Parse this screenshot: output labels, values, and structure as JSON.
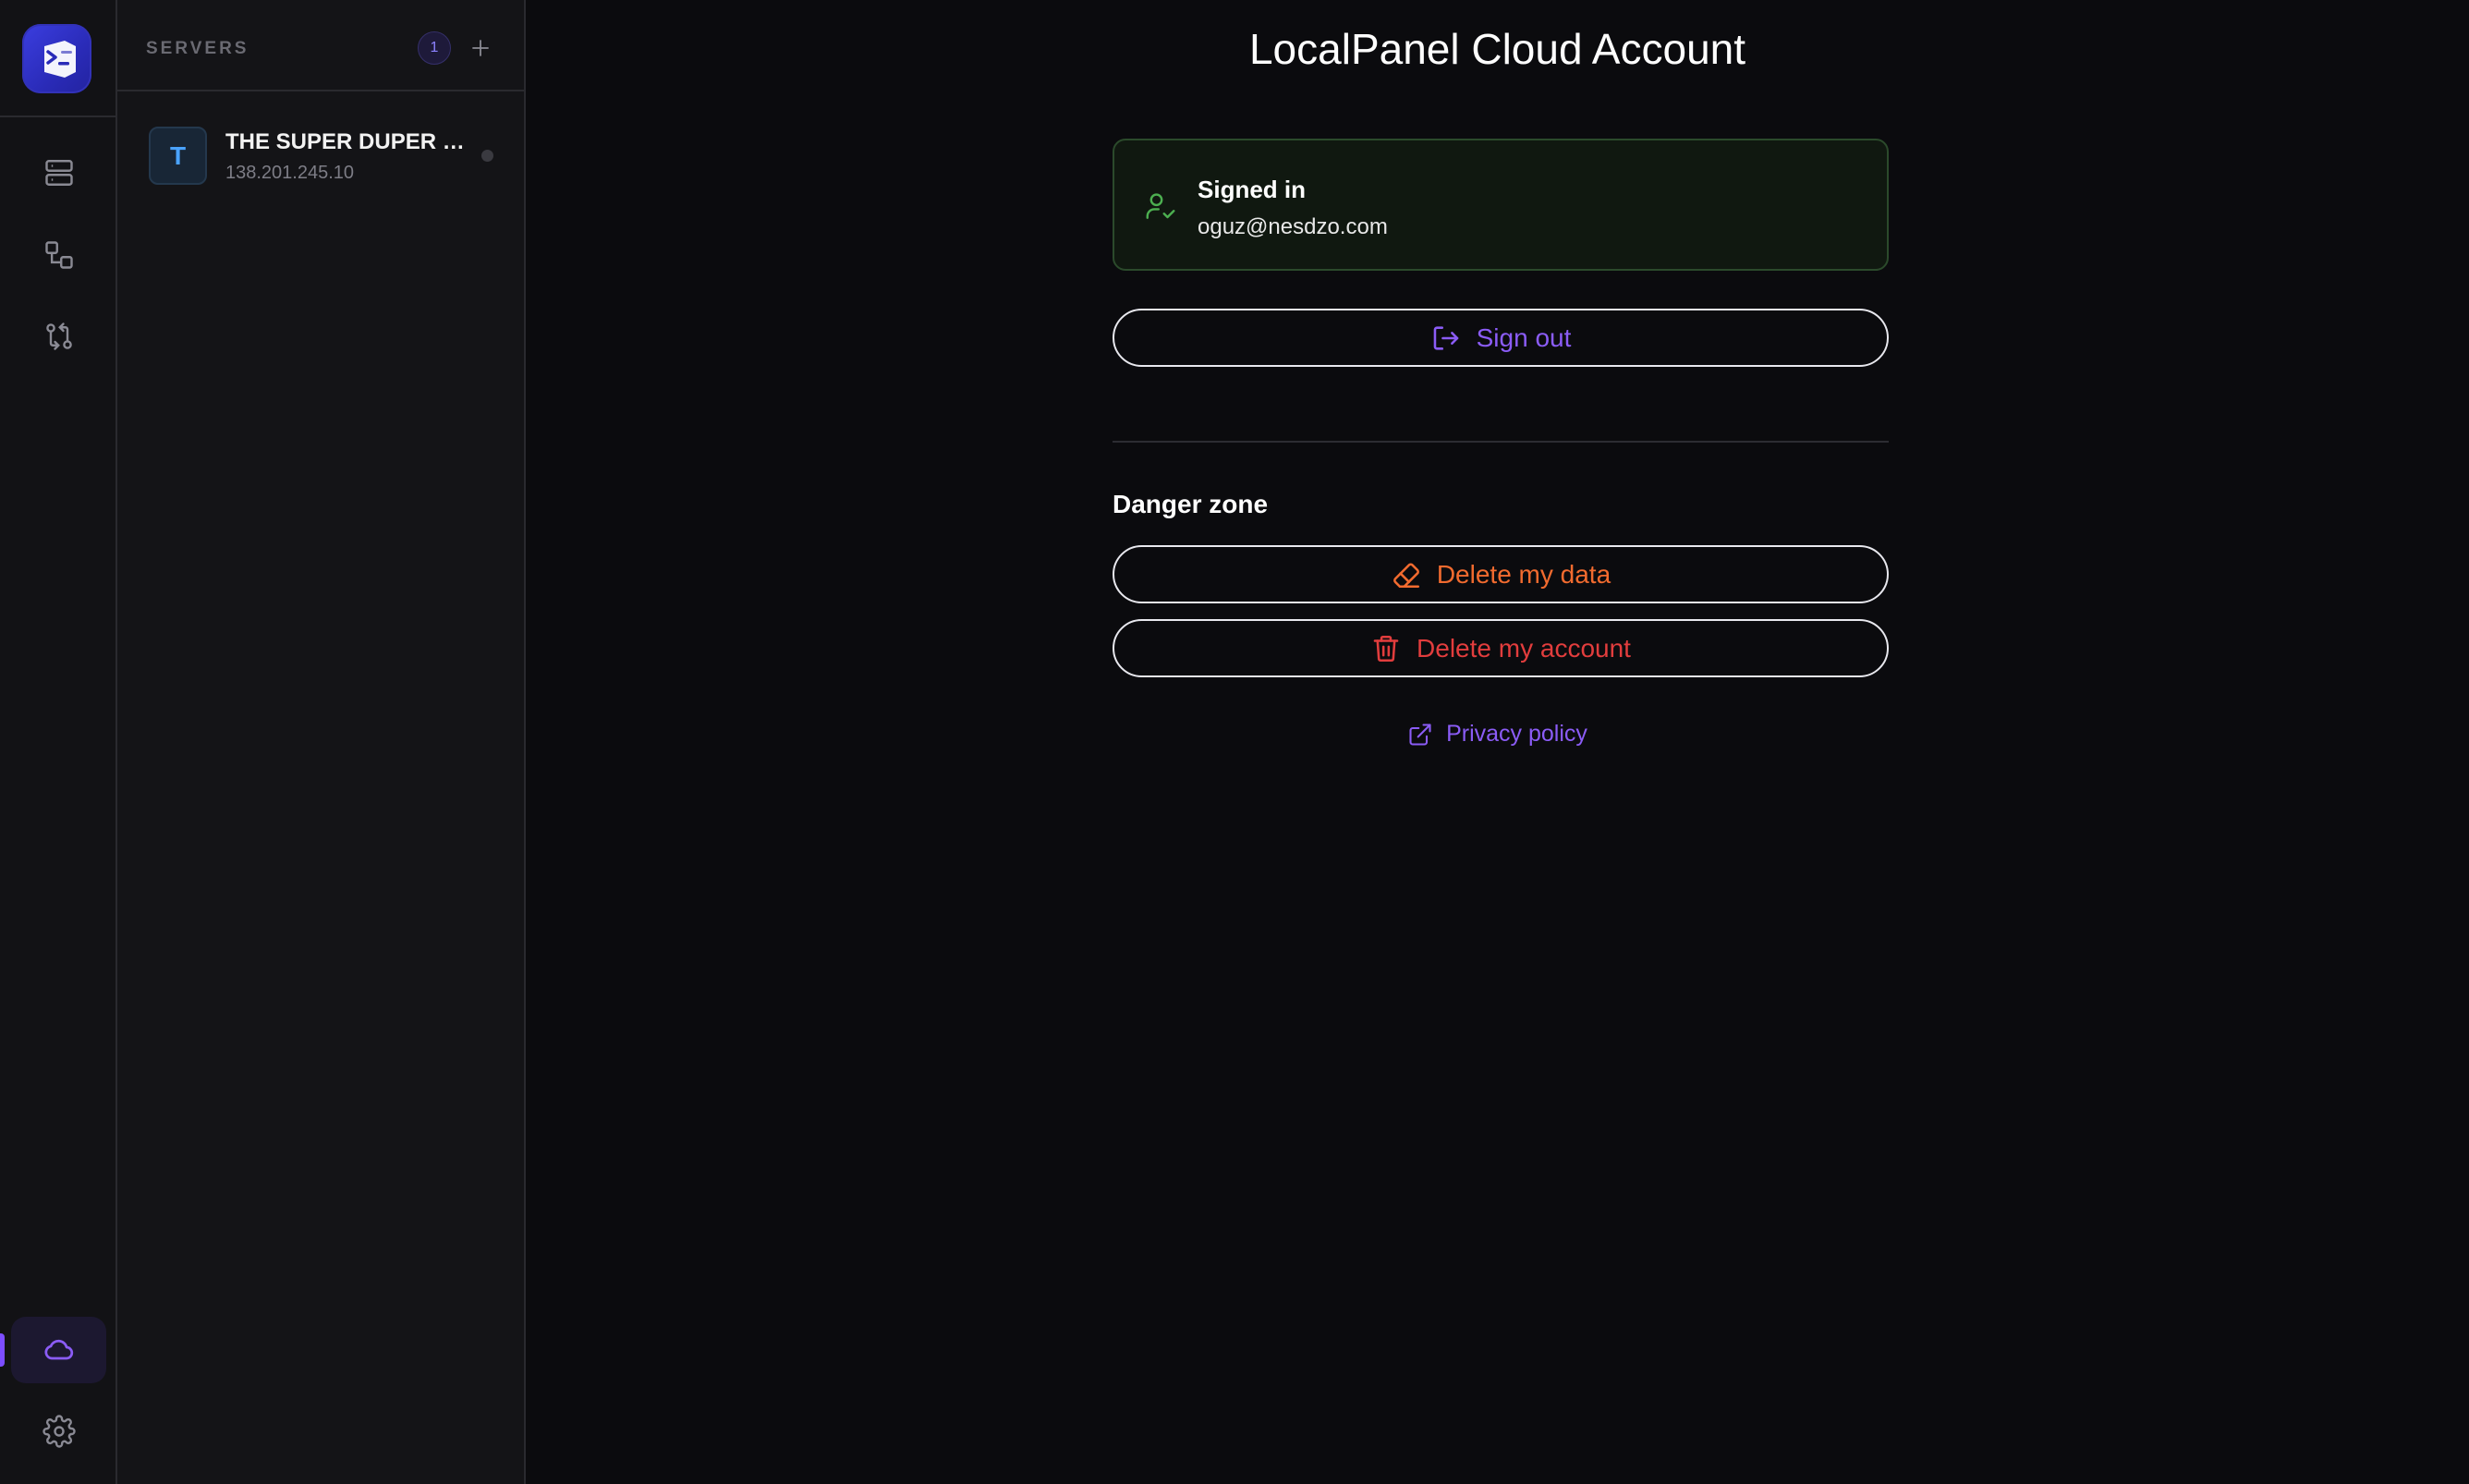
{
  "colors": {
    "accent": "#8b5cf6",
    "success": "#4caf50",
    "warning": "#f26b2f",
    "danger": "#e23d3d",
    "server_avatar": "#4aa3ff"
  },
  "rail": {
    "logo_icon": "localpanel-logo-icon",
    "items": [
      {
        "icon": "servers-icon"
      },
      {
        "icon": "connections-icon"
      },
      {
        "icon": "transfer-icon"
      }
    ],
    "bottom": [
      {
        "icon": "cloud-icon",
        "active": true
      },
      {
        "icon": "gear-icon"
      }
    ]
  },
  "servers": {
    "title": "SERVERS",
    "count": "1",
    "add_icon": "plus-icon",
    "items": [
      {
        "initial": "T",
        "name": "THE SUPER DUPER S...",
        "ip": "138.201.245.10",
        "status": "offline"
      }
    ]
  },
  "main": {
    "title": "LocalPanel Cloud Account",
    "signed_in": {
      "icon": "user-check-icon",
      "label": "Signed in",
      "email": "oguz@nesdzo.com"
    },
    "sign_out": {
      "icon": "log-out-icon",
      "label": "Sign out"
    },
    "danger_zone": {
      "title": "Danger zone",
      "delete_data": {
        "icon": "eraser-icon",
        "label": "Delete my data"
      },
      "delete_account": {
        "icon": "trash-icon",
        "label": "Delete my account"
      }
    },
    "privacy": {
      "icon": "external-link-icon",
      "label": "Privacy policy"
    }
  }
}
